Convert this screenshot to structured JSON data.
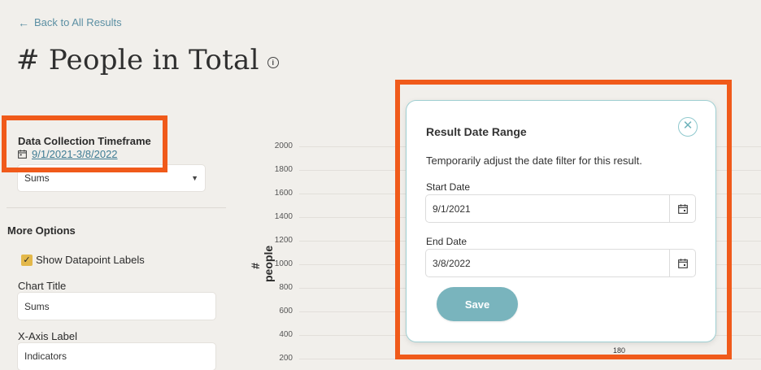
{
  "nav": {
    "back_label": "Back to All Results"
  },
  "page": {
    "title": "# People in Total",
    "info_icon": "info-icon"
  },
  "filters": {
    "timeframe_label": "Data Collection Timeframe",
    "timeframe_value": "9/1/2021-3/8/2022",
    "aggregation_value": "Sums"
  },
  "options": {
    "heading": "More Options",
    "show_labels": {
      "label": "Show Datapoint Labels",
      "checked": true
    },
    "chart_title": {
      "label": "Chart Title",
      "value": "Sums"
    },
    "x_axis": {
      "label": "X-Axis Label",
      "value": "Indicators"
    }
  },
  "chart_data": {
    "type": "bar",
    "ylabel": "# people",
    "yticks": [
      "2000",
      "1800",
      "1600",
      "1400",
      "1200",
      "1000",
      "800",
      "600",
      "400",
      "200"
    ],
    "visible_data_labels": [
      "180"
    ]
  },
  "modal": {
    "title": "Result Date Range",
    "description": "Temporarily adjust the date filter for this result.",
    "start_label": "Start Date",
    "start_value": "9/1/2021",
    "end_label": "End Date",
    "end_value": "3/8/2022",
    "save_label": "Save"
  },
  "colors": {
    "background": "#f1efeb",
    "link": "#3f7c94",
    "highlight": "#f05a1a",
    "checkbox": "#e3b84a",
    "save_button": "#79b4bd",
    "modal_border": "#9fcfd2"
  }
}
